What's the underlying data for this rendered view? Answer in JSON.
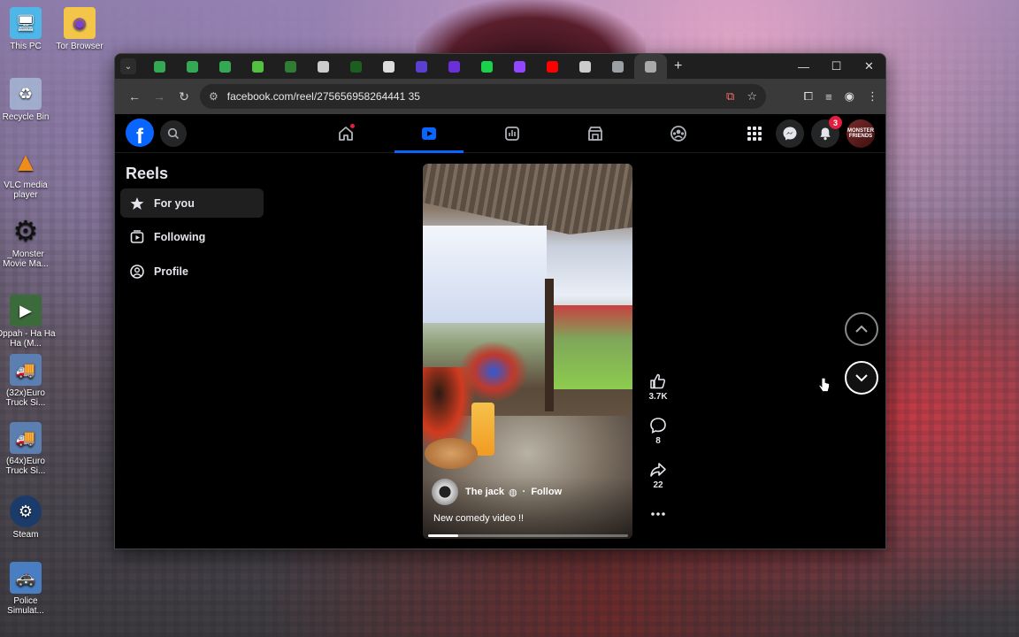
{
  "desktop": {
    "icons": [
      {
        "label": "This PC",
        "icon": "monitor-icon",
        "color": "#4fb6e8"
      },
      {
        "label": "Recycle Bin",
        "icon": "recycle-bin-icon",
        "color": "#9fc7e8"
      },
      {
        "label": "VLC media player",
        "icon": "vlc-icon",
        "color": "#f28c18"
      },
      {
        "label": "_Monster Movie Ma...",
        "icon": "gear-icon",
        "color": "#222222"
      },
      {
        "label": "Oppah - Ha Ha Ha (M...",
        "icon": "video-thumbnail-icon",
        "color": "#3b6b3b"
      },
      {
        "label": "(32x)Euro Truck Si...",
        "icon": "truck-game-icon",
        "color": "#5a7fb0"
      },
      {
        "label": "(64x)Euro Truck Si...",
        "icon": "truck-game-icon",
        "color": "#5a7fb0"
      },
      {
        "label": "Steam",
        "icon": "steam-icon",
        "color": "#1b3c6b"
      },
      {
        "label": "Police Simulat...",
        "icon": "police-game-icon",
        "color": "#4a7ec2"
      },
      {
        "label": "Tor Browser",
        "icon": "folder-icon",
        "color": "#f3c649"
      }
    ]
  },
  "browser": {
    "tab_favicon_colors": [
      "#34a853",
      "#34a853",
      "#34a853",
      "#53c13f",
      "#2e7d32",
      "#cccccc",
      "#1b5e20",
      "#dddddd",
      "#5b3fd0",
      "#6a2fd8",
      "#1bd04a",
      "#9146ff",
      "#ff0000",
      "#cccccc",
      "#9aa0a6",
      "#aaaaaa"
    ],
    "url": "facebook.com/reel/275656958264441 35"
  },
  "facebook": {
    "brand_color": "#0866ff",
    "notification_count": "3",
    "avatar_text": "MONSTER FRIENDS",
    "sidebar": {
      "title": "Reels",
      "items": [
        {
          "label": "For you",
          "icon": "star-icon"
        },
        {
          "label": "Following",
          "icon": "following-icon"
        },
        {
          "label": "Profile",
          "icon": "profile-icon"
        }
      ]
    },
    "reel": {
      "author": "The jack",
      "follow": "Follow",
      "caption": "New comedy video !!",
      "progress": 0.15,
      "likes": "3.7K",
      "comments": "8",
      "shares": "22"
    }
  }
}
